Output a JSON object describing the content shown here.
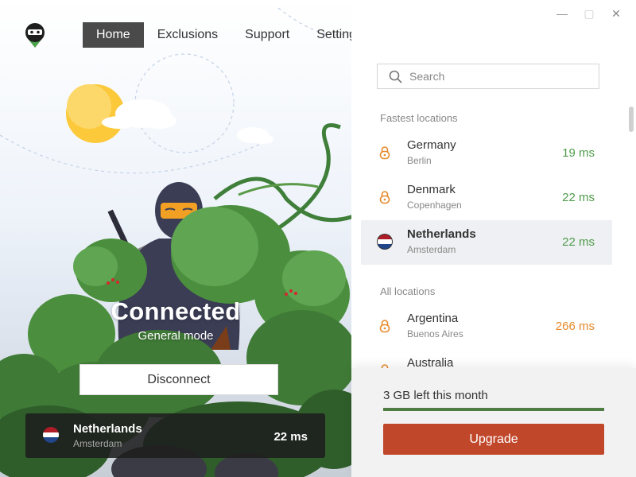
{
  "nav": {
    "tabs": [
      {
        "label": "Home",
        "active": true
      },
      {
        "label": "Exclusions"
      },
      {
        "label": "Support"
      },
      {
        "label": "Settings"
      }
    ]
  },
  "status": {
    "title": "Connected",
    "mode": "General mode",
    "disconnect_label": "Disconnect"
  },
  "current_location": {
    "country": "Netherlands",
    "city": "Amsterdam",
    "ping": "22 ms"
  },
  "search": {
    "placeholder": "Search"
  },
  "fastest": {
    "label": "Fastest locations",
    "items": [
      {
        "country": "Germany",
        "city": "Berlin",
        "ping": "19 ms",
        "icon": "lock-icon"
      },
      {
        "country": "Denmark",
        "city": "Copenhagen",
        "ping": "22 ms",
        "icon": "lock-icon"
      },
      {
        "country": "Netherlands",
        "city": "Amsterdam",
        "ping": "22 ms",
        "icon": "netherlands-flag-icon",
        "selected": true
      }
    ]
  },
  "all": {
    "label": "All locations",
    "items": [
      {
        "country": "Argentina",
        "city": "Buenos Aires",
        "ping": "266 ms",
        "icon": "lock-icon"
      },
      {
        "country": "Australia",
        "city": "",
        "ping": "",
        "icon": "lock-icon"
      }
    ]
  },
  "quota": {
    "text": "3 GB left this month",
    "fraction": 1.0,
    "upgrade_label": "Upgrade"
  },
  "colors": {
    "accent_green": "#4f9b4b",
    "ping_orange": "#e6892a",
    "upgrade_red": "#c1472b",
    "nav_active": "#4a4a4a"
  }
}
